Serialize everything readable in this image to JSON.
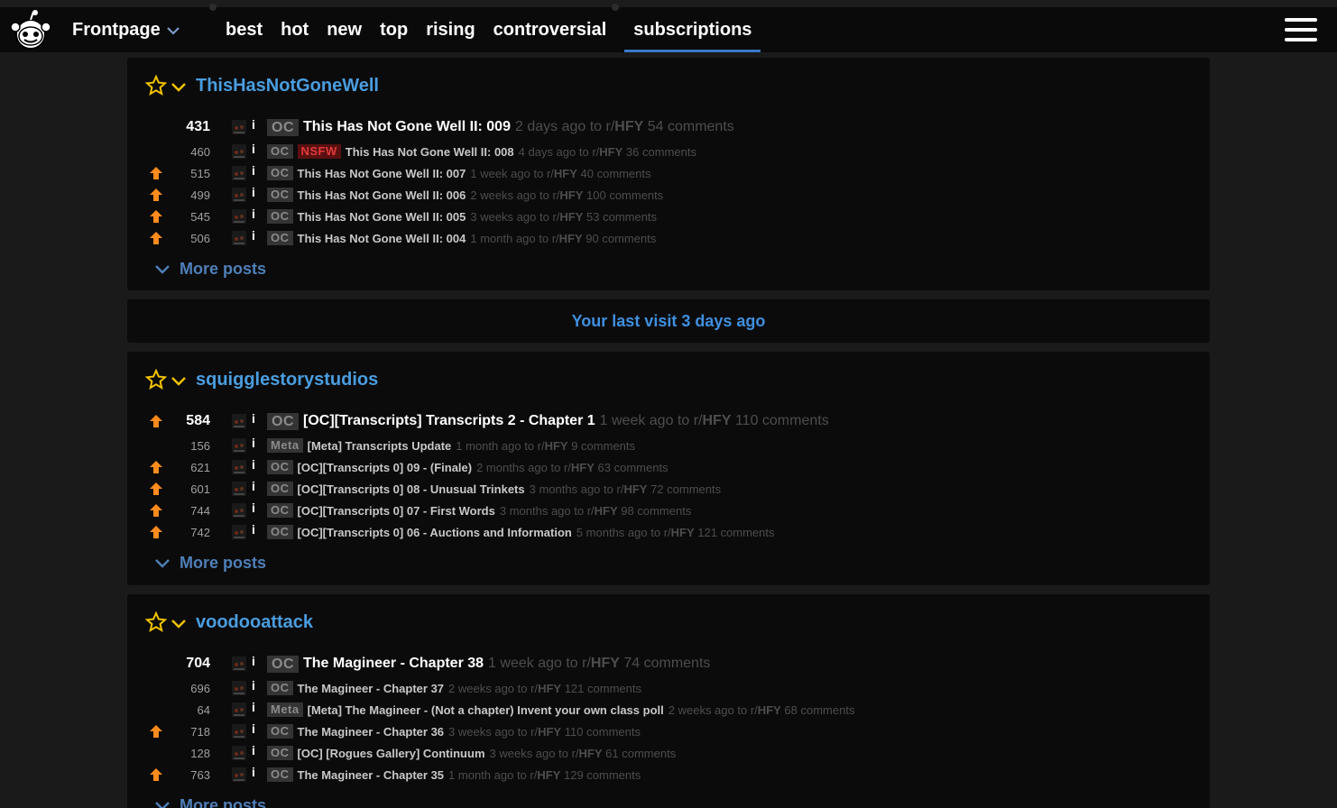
{
  "header": {
    "title": "Frontpage",
    "tabs": [
      "best",
      "hot",
      "new",
      "top",
      "rising",
      "controversial",
      "subscriptions"
    ],
    "active_tab": "subscriptions"
  },
  "last_visit": "Your last visit 3 days ago",
  "more_label": "More posts",
  "sections": [
    {
      "name": "ThisHasNotGoneWell",
      "posts": [
        {
          "score": "431",
          "upvoted": false,
          "flair": "OC",
          "nsfw": "",
          "title": "This Has Not Gone Well II: 009",
          "time": "2 days ago",
          "to": "to r/",
          "sub": "HFY",
          "comments": "54 comments"
        },
        {
          "score": "460",
          "upvoted": false,
          "flair": "OC",
          "nsfw": "NSFW",
          "title": "This Has Not Gone Well II: 008",
          "time": "4 days ago",
          "to": "to r/",
          "sub": "HFY",
          "comments": "36 comments"
        },
        {
          "score": "515",
          "upvoted": true,
          "flair": "OC",
          "nsfw": "",
          "title": "This Has Not Gone Well II: 007",
          "time": "1 week ago",
          "to": "to r/",
          "sub": "HFY",
          "comments": "40 comments"
        },
        {
          "score": "499",
          "upvoted": true,
          "flair": "OC",
          "nsfw": "",
          "title": "This Has Not Gone Well II: 006",
          "time": "2 weeks ago",
          "to": "to r/",
          "sub": "HFY",
          "comments": "100 comments"
        },
        {
          "score": "545",
          "upvoted": true,
          "flair": "OC",
          "nsfw": "",
          "title": "This Has Not Gone Well II: 005",
          "time": "3 weeks ago",
          "to": "to r/",
          "sub": "HFY",
          "comments": "53 comments"
        },
        {
          "score": "506",
          "upvoted": true,
          "flair": "OC",
          "nsfw": "",
          "title": "This Has Not Gone Well II: 004",
          "time": "1 month ago",
          "to": "to r/",
          "sub": "HFY",
          "comments": "90 comments"
        }
      ]
    },
    {
      "name": "squigglestorystudios",
      "posts": [
        {
          "score": "584",
          "upvoted": true,
          "flair": "OC",
          "nsfw": "",
          "title": "[OC][Transcripts] Transcripts 2 - Chapter 1",
          "time": "1 week ago",
          "to": "to r/",
          "sub": "HFY",
          "comments": "110 comments"
        },
        {
          "score": "156",
          "upvoted": false,
          "flair": "Meta",
          "nsfw": "",
          "title": "[Meta] Transcripts Update",
          "time": "1 month ago",
          "to": "to r/",
          "sub": "HFY",
          "comments": "9 comments"
        },
        {
          "score": "621",
          "upvoted": true,
          "flair": "OC",
          "nsfw": "",
          "title": "[OC][Transcripts 0] 09 - (Finale)",
          "time": "2 months ago",
          "to": "to r/",
          "sub": "HFY",
          "comments": "63 comments"
        },
        {
          "score": "601",
          "upvoted": true,
          "flair": "OC",
          "nsfw": "",
          "title": "[OC][Transcripts 0] 08 - Unusual Trinkets",
          "time": "3 months ago",
          "to": "to r/",
          "sub": "HFY",
          "comments": "72 comments"
        },
        {
          "score": "744",
          "upvoted": true,
          "flair": "OC",
          "nsfw": "",
          "title": "[OC][Transcripts 0] 07 - First Words",
          "time": "3 months ago",
          "to": "to r/",
          "sub": "HFY",
          "comments": "98 comments"
        },
        {
          "score": "742",
          "upvoted": true,
          "flair": "OC",
          "nsfw": "",
          "title": "[OC][Transcripts 0] 06 - Auctions and Information",
          "time": "5 months ago",
          "to": "to r/",
          "sub": "HFY",
          "comments": "121 comments"
        }
      ]
    },
    {
      "name": "voodooattack",
      "posts": [
        {
          "score": "704",
          "upvoted": false,
          "flair": "OC",
          "nsfw": "",
          "title": "The Magineer - Chapter 38",
          "time": "1 week ago",
          "to": "to r/",
          "sub": "HFY",
          "comments": "74 comments"
        },
        {
          "score": "696",
          "upvoted": false,
          "flair": "OC",
          "nsfw": "",
          "title": "The Magineer - Chapter 37",
          "time": "2 weeks ago",
          "to": "to r/",
          "sub": "HFY",
          "comments": "121 comments"
        },
        {
          "score": "64",
          "upvoted": false,
          "flair": "Meta",
          "nsfw": "",
          "title": "[Meta] The Magineer - (Not a chapter) Invent your own class poll",
          "time": "2 weeks ago",
          "to": "to r/",
          "sub": "HFY",
          "comments": "68 comments"
        },
        {
          "score": "718",
          "upvoted": true,
          "flair": "OC",
          "nsfw": "",
          "title": "The Magineer - Chapter 36",
          "time": "3 weeks ago",
          "to": "to r/",
          "sub": "HFY",
          "comments": "110 comments"
        },
        {
          "score": "128",
          "upvoted": false,
          "flair": "OC",
          "nsfw": "",
          "title": "[OC] [Rogues Gallery] Continuum",
          "time": "3 weeks ago",
          "to": "to r/",
          "sub": "HFY",
          "comments": "61 comments"
        },
        {
          "score": "763",
          "upvoted": true,
          "flair": "OC",
          "nsfw": "",
          "title": "The Magineer - Chapter 35",
          "time": "1 month ago",
          "to": "to r/",
          "sub": "HFY",
          "comments": "129 comments"
        }
      ]
    }
  ]
}
